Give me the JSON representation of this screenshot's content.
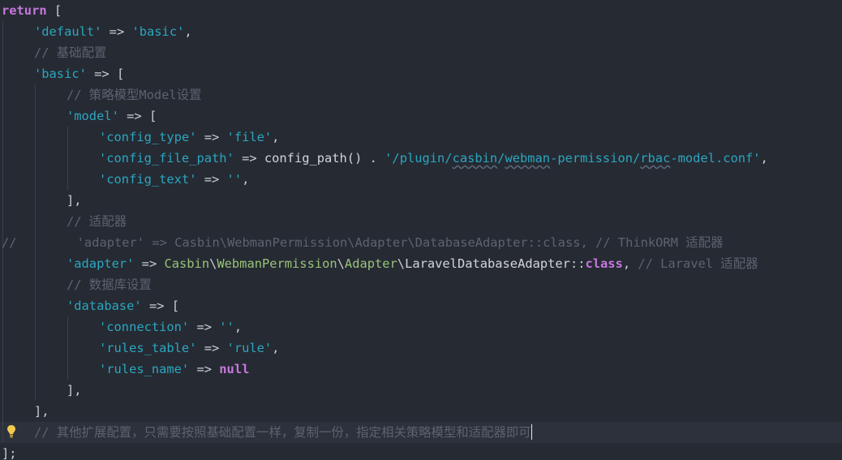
{
  "code": {
    "l1": {
      "kw": "return",
      "rest": " ["
    },
    "l2": {
      "key": "'default'",
      "arrow": " => ",
      "val": "'basic'",
      "end": ","
    },
    "l3": {
      "comment": "// 基础配置"
    },
    "l4": {
      "key": "'basic'",
      "arrow": " => ",
      "open": "["
    },
    "l5": {
      "comment": "// 策略模型Model设置"
    },
    "l6": {
      "key": "'model'",
      "arrow": " => ",
      "open": "["
    },
    "l7": {
      "key": "'config_type'",
      "arrow": " => ",
      "val": "'file'",
      "end": ","
    },
    "l8": {
      "key": "'config_file_path'",
      "arrow": " => ",
      "fn": "config_path()",
      "dot": " . ",
      "q1": "'/plugin/",
      "p1": "casbin",
      "s1": "/",
      "p2": "webman",
      "s2": "-permission/",
      "p3": "rbac",
      "s3": "-model.conf'",
      "end": ","
    },
    "l9": {
      "key": "'config_text'",
      "arrow": " => ",
      "val": "''",
      "end": ","
    },
    "l10": {
      "close": "],"
    },
    "l11": {
      "comment": "// 适配器"
    },
    "l12": {
      "text": "//        'adapter' => Casbin\\WebmanPermission\\Adapter\\DatabaseAdapter::class, // ThinkORM 适配器"
    },
    "l13": {
      "key": "'adapter'",
      "arrow": " => ",
      "ns1": "Casbin",
      "bs1": "\\",
      "ns2": "WebmanPermission",
      "bs2": "\\",
      "ns3": "Adapter",
      "bs3": "\\",
      "cls": "LaravelDatabaseAdapter",
      "dc": "::",
      "kw": "class",
      "comma": ", ",
      "comment": "// Laravel 适配器"
    },
    "l14": {
      "comment": "// 数据库设置"
    },
    "l15": {
      "key": "'database'",
      "arrow": " => ",
      "open": "["
    },
    "l16": {
      "key": "'connection'",
      "arrow": " => ",
      "val": "''",
      "end": ","
    },
    "l17": {
      "key": "'rules_table'",
      "arrow": " => ",
      "val": "'rule'",
      "end": ","
    },
    "l18": {
      "key": "'rules_name'",
      "arrow": " => ",
      "kw": "null"
    },
    "l19": {
      "close": "],"
    },
    "l20": {
      "close": "],"
    },
    "l21": {
      "comment": "// 其他扩展配置，只需要按照基础配置一样，复制一份，指定相关策略模型和适配器即可"
    },
    "l22": {
      "close": "];"
    }
  },
  "icons": {
    "hint": "lightbulb-icon"
  },
  "colors": {
    "background": "#262a33",
    "keyword": "#c678dd",
    "string": "#2aa7bf",
    "comment": "#5c6370",
    "class": "#98c379"
  }
}
